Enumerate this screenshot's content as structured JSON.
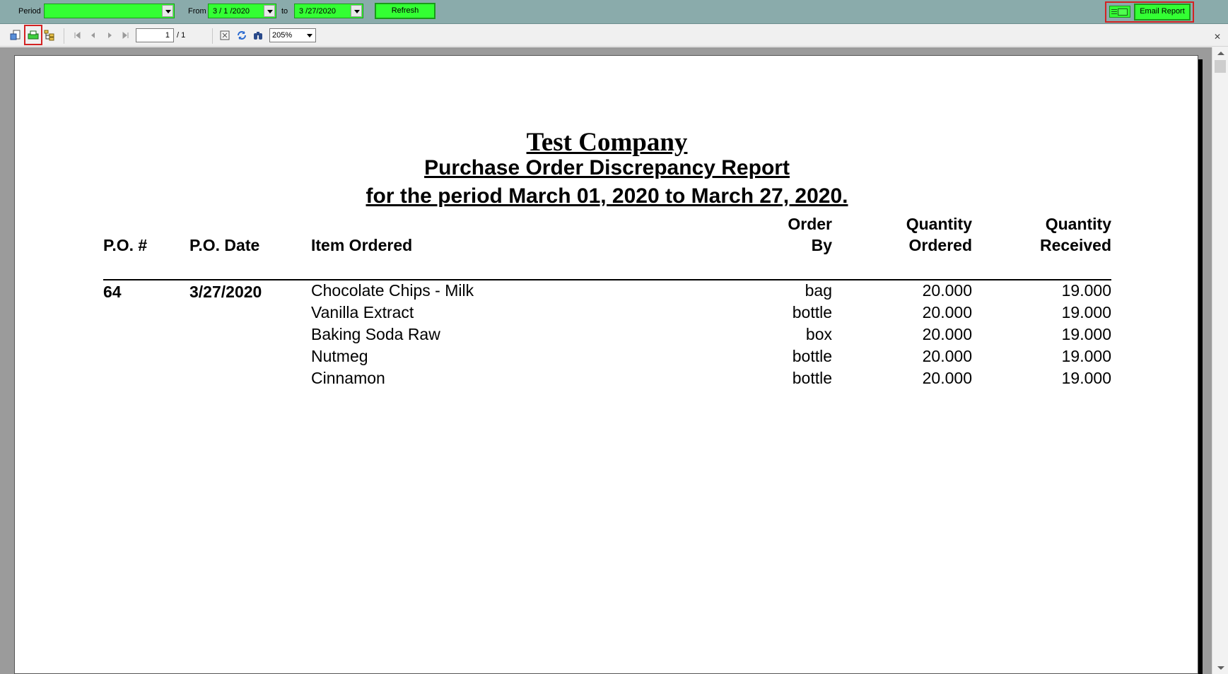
{
  "filter_bar": {
    "period_label": "Period",
    "period_value": "",
    "from_label": "From",
    "from_date": "3 / 1 /2020",
    "to_label": "to",
    "to_date": "3 /27/2020",
    "refresh_label": "Refresh",
    "email_label": "Email Report",
    "accent_color": "#33ff33"
  },
  "toolbar": {
    "page_current": "1",
    "page_total": "/ 1",
    "zoom": "205%"
  },
  "report": {
    "company": "Test Company",
    "title": "Purchase Order Discrepancy Report",
    "period": "for the period March 01, 2020 to March 27, 2020.",
    "headers": {
      "po_num": "P.O. #",
      "po_date": "P.O. Date",
      "item": "Item Ordered",
      "order_by_1": "Order",
      "order_by_2": "By",
      "qty_ord_1": "Quantity",
      "qty_ord_2": "Ordered",
      "qty_rec_1": "Quantity",
      "qty_rec_2": "Received"
    },
    "po_number": "64",
    "po_date": "3/27/2020",
    "rows": [
      {
        "item": "Chocolate Chips - Milk",
        "unit": "bag",
        "ordered": "20.000",
        "received": "19.000"
      },
      {
        "item": "Vanilla Extract",
        "unit": "bottle",
        "ordered": "20.000",
        "received": "19.000"
      },
      {
        "item": "Baking Soda Raw",
        "unit": "box",
        "ordered": "20.000",
        "received": "19.000"
      },
      {
        "item": "Nutmeg",
        "unit": "bottle",
        "ordered": "20.000",
        "received": "19.000"
      },
      {
        "item": "Cinnamon",
        "unit": "bottle",
        "ordered": "20.000",
        "received": "19.000"
      }
    ]
  }
}
